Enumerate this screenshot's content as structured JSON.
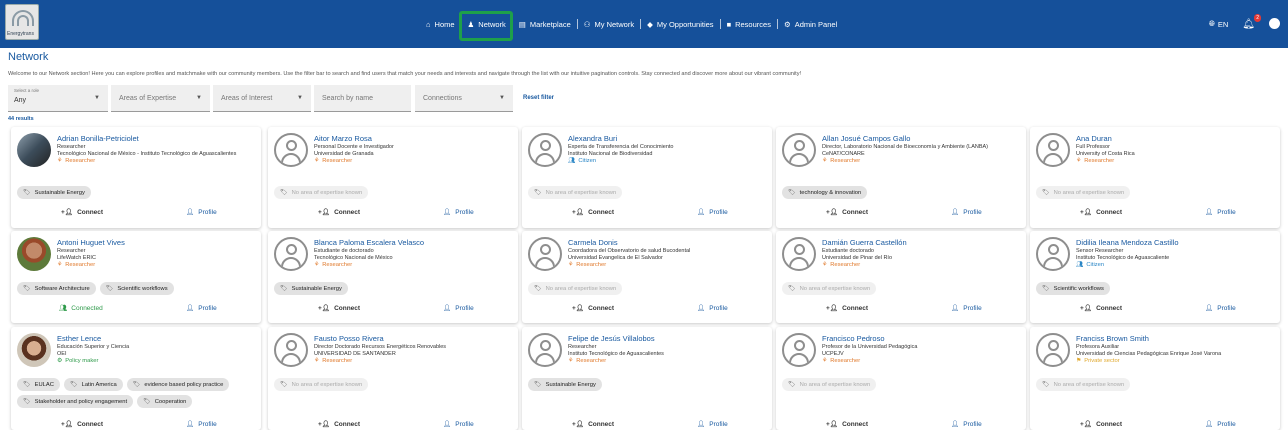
{
  "nav": {
    "logo_text": "Energytrans",
    "items": [
      {
        "label": "Home",
        "icon": "home-icon",
        "glyph": "⌂"
      },
      {
        "label": "Network",
        "icon": "network-icon",
        "glyph": "▲▲"
      },
      {
        "label": "Marketplace",
        "icon": "marketplace-icon",
        "glyph": "▤"
      },
      {
        "label": "My Network",
        "icon": "my-network-icon",
        "glyph": "⚇"
      },
      {
        "label": "My Opportunities",
        "icon": "opportunities-icon",
        "glyph": "◆"
      },
      {
        "label": "Resources",
        "icon": "folder-icon",
        "glyph": "■"
      },
      {
        "label": "Admin Panel",
        "icon": "admin-icon",
        "glyph": "⚙"
      }
    ],
    "language": "EN",
    "notifications": "2"
  },
  "page": {
    "title": "Network",
    "intro": "Welcome to our Network section! Here you can explore profiles and matchmake with our community members. Use the filter bar to search and find users that match your needs and interests and navigate through the list with our intuitive pagination controls. Stay connected and discover more about our vibrant community!",
    "results": "44 results"
  },
  "filters": {
    "role_label": "Select a role",
    "role_value": "Any",
    "expertise_placeholder": "Areas of Expertise",
    "interest_placeholder": "Areas of Interest",
    "search_placeholder": "Search by name",
    "connections_placeholder": "Connections",
    "reset": "Reset filter"
  },
  "labels": {
    "connect": "Connect",
    "connected": "Connected",
    "profile": "Profile",
    "no_expertise": "No area of expertise known"
  },
  "cards": [
    {
      "name": "Adrian  Bonilla-Petriciolet",
      "l1": "Researcher",
      "l2": "Tecnológico Nacional de México - Instituto Tecnológico de Aguascalientes",
      "l3": "",
      "role": "Researcher",
      "role_type": "researcher",
      "tags": [
        "Sustainable Energy"
      ],
      "avatar": "photo1",
      "status": "connect"
    },
    {
      "name": "Aitor Marzo Rosa",
      "l1": "Personal Docente e Investigador",
      "l2": "Universidad de Granada",
      "l3": "",
      "role": "Researcher",
      "role_type": "researcher",
      "tags": [],
      "avatar": "ph",
      "status": "connect"
    },
    {
      "name": "Alexandra Buri",
      "l1": "Experta de Transferencia del Conocimiento",
      "l2": "Instituto Nacional de Biodiversidad",
      "l3": "",
      "role": "Citizen",
      "role_type": "citizen",
      "tags": [],
      "avatar": "ph",
      "status": "connect"
    },
    {
      "name": "Allan Josué Campos Gallo",
      "l1": "Director, Laboratorio Nacional de Bioeconomía y Ambiente (LANBA)",
      "l2": "CeNAT/CONARE",
      "l3": "",
      "role": "Researcher",
      "role_type": "researcher",
      "tags": [
        "technology & innovation"
      ],
      "avatar": "ph",
      "status": "connect"
    },
    {
      "name": "Ana Duran",
      "l1": "Full Professor",
      "l2": "University of Costa Rica",
      "l3": "",
      "role": "Researcher",
      "role_type": "researcher",
      "tags": [],
      "avatar": "ph",
      "status": "connect"
    },
    {
      "name": "Antoni Huguet Vives",
      "l1": "Researcher",
      "l2": "LifeWatch ERIC",
      "l3": "",
      "role": "Researcher",
      "role_type": "researcher",
      "tags": [
        "Software Architecture",
        "Scientific workflows"
      ],
      "avatar": "photo2",
      "status": "connected"
    },
    {
      "name": "Blanca Paloma Escalera Velasco",
      "l1": "Estudiante de doctorado",
      "l2": "Tecnológico Nacional de México",
      "l3": "",
      "role": "Researcher",
      "role_type": "researcher",
      "tags": [
        "Sustainable Energy"
      ],
      "avatar": "ph",
      "status": "connect"
    },
    {
      "name": "Carmela Donis",
      "l1": "Coordadora del Observatorio de salud Bucodental",
      "l2": "Universidad Evangelica de El Salvador",
      "l3": "",
      "role": "Researcher",
      "role_type": "researcher",
      "tags": [],
      "avatar": "ph",
      "status": "connect"
    },
    {
      "name": "Damián Guerra Castellón",
      "l1": "Estudiante doctorado",
      "l2": "Universidad de Pinar del Río",
      "l3": "",
      "role": "Researcher",
      "role_type": "researcher",
      "tags": [],
      "avatar": "ph",
      "status": "connect"
    },
    {
      "name": "Didilia Ileana Mendoza Castillo",
      "l1": "Sensor Researcher",
      "l2": "Instituto Tecnológico de Aguascaliente",
      "l3": "",
      "role": "Citizen",
      "role_type": "citizen",
      "tags": [
        "Scientific workflows"
      ],
      "avatar": "ph",
      "status": "connect"
    },
    {
      "name": "Esther Lence",
      "l1": "Educación Superior y Ciencia",
      "l2": "OEI",
      "l3": "",
      "role": "Policy maker",
      "role_type": "policy",
      "tags": [
        "EULAC",
        "Latin America",
        "evidence based policy practice",
        "Stakeholder and policy engagement",
        "Cooperation"
      ],
      "avatar": "photo3",
      "status": "connect"
    },
    {
      "name": "Fausto Posso Rivera",
      "l1": "Director Doctorado Recursos Energéticos Renovables",
      "l2": "UNIVERSIDAD DE SANTANDER",
      "l3": "",
      "role": "Researcher",
      "role_type": "researcher",
      "tags": [],
      "avatar": "ph",
      "status": "connect"
    },
    {
      "name": "Felipe de Jesús Villalobos",
      "l1": "Researcher",
      "l2": "Instituto Tecnológico de Aguascalientes",
      "l3": "",
      "role": "Researcher",
      "role_type": "researcher",
      "tags": [
        "Sustainable Energy"
      ],
      "avatar": "ph",
      "status": "connect"
    },
    {
      "name": "Francisco Pedroso",
      "l1": "Profesor de la Universidad Pedagógica",
      "l2": "UCPEJV",
      "l3": "",
      "role": "Researcher",
      "role_type": "researcher",
      "tags": [],
      "avatar": "ph",
      "status": "connect"
    },
    {
      "name": "Franciss  Brown Smith",
      "l1": "Profesora Auxiliar",
      "l2": "Universidad de Ciencias Pedagógicas Enrique José Varona",
      "l3": "",
      "role": "Private sector",
      "role_type": "private",
      "tags": [],
      "avatar": "ph",
      "status": "connect"
    }
  ]
}
